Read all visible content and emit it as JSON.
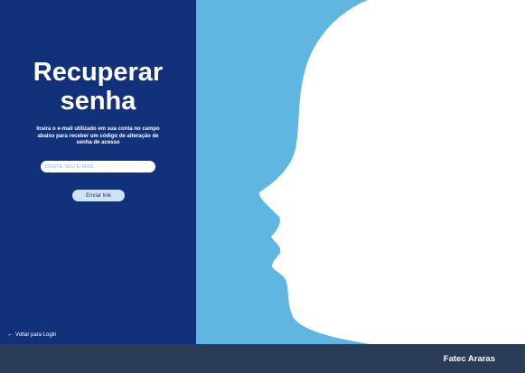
{
  "recovery": {
    "title_line1": "Recuperar",
    "title_line2": "senha",
    "instructions": "Insira o e-mail utilizado em sua conta no campo abaixo para receber um código de alteração de senha de acesso",
    "email_placeholder": "DIGITE SEU E-MAIL",
    "email_value": "",
    "send_label": "Enviar link",
    "back_label": "Voltar para Login",
    "back_icon": "arrow-left-icon"
  },
  "footer": {
    "brand": "Fatec Araras"
  },
  "colors": {
    "left_panel": "#11317a",
    "right_panel": "#5fb6e0",
    "silhouette": "#ffffff",
    "footer": "#2a3c57",
    "button": "#cfe3f7",
    "placeholder": "#8fb5e6"
  }
}
